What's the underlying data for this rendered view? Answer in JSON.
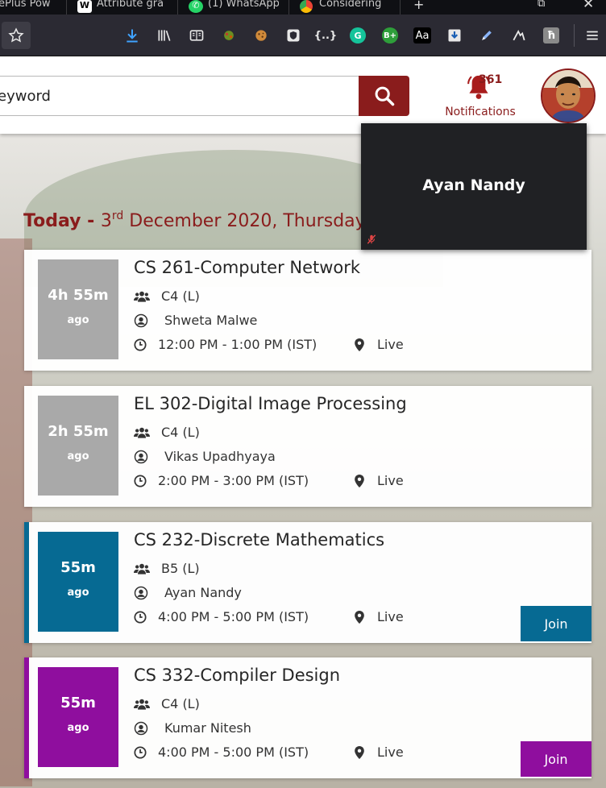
{
  "browser": {
    "tabs": [
      {
        "label": "ePlus Pow",
        "icon": "page-icon"
      },
      {
        "label": "Attribute gra",
        "icon": "wikipedia-icon"
      },
      {
        "label": "(1) WhatsApp",
        "icon": "whatsapp-icon"
      },
      {
        "label": "Considering",
        "icon": "chrome-icon"
      }
    ],
    "new_tab_label": "+",
    "toolbar_icons": [
      "star-icon",
      "download-icon",
      "library-icon",
      "reader-view-icon",
      "extension-bug-icon",
      "cookie-icon",
      "shield-icon",
      "json-icon",
      "grammarly-icon",
      "bplus-icon",
      "font-aa-icon",
      "download-box-icon",
      "pen-icon",
      "ghostery-icon",
      "hash-icon",
      "menu-icon"
    ],
    "ext_labels": {
      "json": "{..}",
      "grammarly": "G",
      "bplus": "B+",
      "font": "Aa",
      "hash": "ħ"
    }
  },
  "header": {
    "search_value": "eyword",
    "notifications": {
      "count": "361",
      "label": "Notifications"
    },
    "brand_color": "#8a1c1c"
  },
  "video_tile": {
    "name": "Ayan Nandy",
    "mic_muted": true
  },
  "today": {
    "prefix": "Today - ",
    "day": "3",
    "suffix": "rd",
    "rest": " December 2020, Thursday"
  },
  "classes": [
    {
      "time_ago": "4h 55m",
      "ago": "ago",
      "course": "CS 261-Computer Network",
      "group": "C4 (L)",
      "teacher": "Shweta Malwe",
      "time": "12:00 PM - 1:00 PM (IST)",
      "location": "Live",
      "status": "past"
    },
    {
      "time_ago": "2h 55m",
      "ago": "ago",
      "course": "EL 302-Digital Image Processing",
      "group": "C4 (L)",
      "teacher": "Vikas Upadhyaya",
      "time": "2:00 PM - 3:00 PM (IST)",
      "location": "Live",
      "status": "past"
    },
    {
      "time_ago": "55m",
      "ago": "ago",
      "course": "CS 232-Discrete Mathematics",
      "group": "B5 (L)",
      "teacher": "Ayan Nandy",
      "time": "4:00 PM - 5:00 PM (IST)",
      "location": "Live",
      "status": "live",
      "color": "#066a93",
      "join_label": "Join"
    },
    {
      "time_ago": "55m",
      "ago": "ago",
      "course": "CS 332-Compiler Design",
      "group": "C4 (L)",
      "teacher": "Kumar Nitesh",
      "time": "4:00 PM - 5:00 PM (IST)",
      "location": "Live",
      "status": "live",
      "color": "#8f0e9e",
      "join_label": "Join"
    }
  ]
}
